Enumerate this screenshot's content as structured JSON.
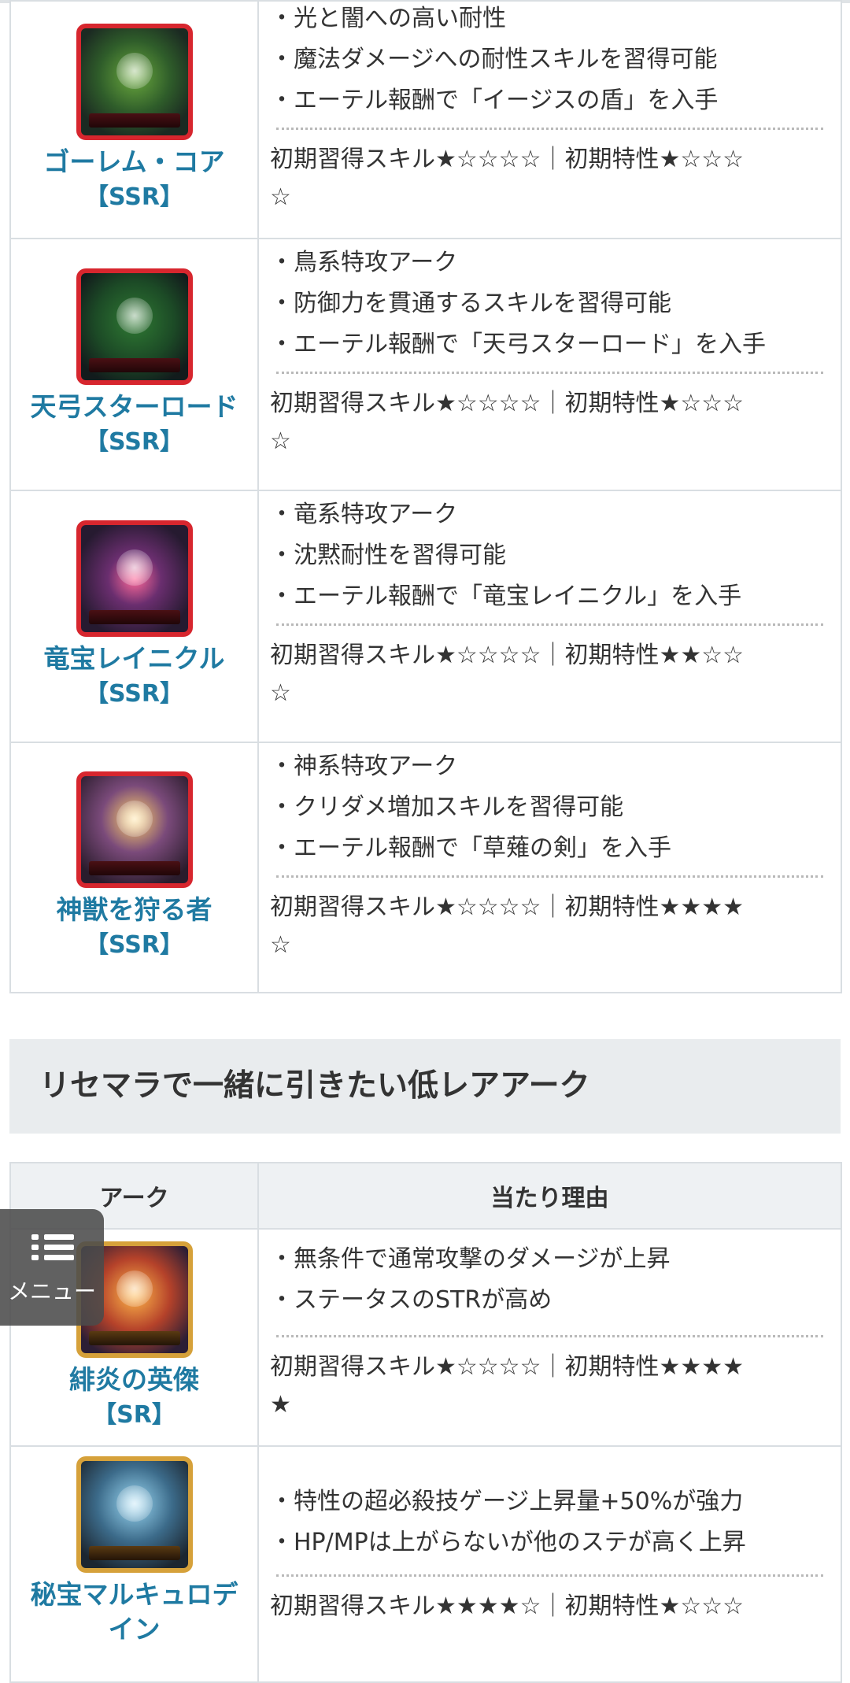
{
  "top_table": {
    "rows": [
      {
        "name": "ゴーレム・コア",
        "rarity": "【SSR】",
        "bullets": [
          "・光と闇への高い耐性",
          "・魔法ダメージへの耐性スキルを習得可能",
          "・エーテル報酬で「イージスの盾」を入手"
        ],
        "stars_line1": "初期習得スキル★☆☆☆☆｜初期特性★☆☆☆",
        "stars_line2": "☆"
      },
      {
        "name": "天弓スターロード",
        "rarity": "【SSR】",
        "bullets": [
          "・鳥系特攻アーク",
          "・防御力を貫通するスキルを習得可能",
          "・エーテル報酬で「天弓スターロード」を入手"
        ],
        "stars_line1": "初期習得スキル★☆☆☆☆｜初期特性★☆☆☆",
        "stars_line2": "☆"
      },
      {
        "name": "竜宝レイニクル",
        "rarity": "【SSR】",
        "bullets": [
          "・竜系特攻アーク",
          "・沈黙耐性を習得可能",
          "・エーテル報酬で「竜宝レイニクル」を入手"
        ],
        "stars_line1": "初期習得スキル★☆☆☆☆｜初期特性★★☆☆",
        "stars_line2": "☆"
      },
      {
        "name": "神獣を狩る者",
        "rarity": "【SSR】",
        "bullets": [
          "・神系特攻アーク",
          "・クリダメ増加スキルを習得可能",
          "・エーテル報酬で「草薙の剣」を入手"
        ],
        "stars_line1": "初期習得スキル★☆☆☆☆｜初期特性★★★★",
        "stars_line2": "☆"
      }
    ]
  },
  "section": {
    "heading": "リセマラで一緒に引きたい低レアアーク"
  },
  "bottom_table": {
    "headers": [
      "アーク",
      "当たり理由"
    ],
    "rows": [
      {
        "name": "緋炎の英傑",
        "rarity": "【SR】",
        "bullets": [
          "・無条件で通常攻撃のダメージが上昇",
          "・ステータスのSTRが高め"
        ],
        "stars_line1": "初期習得スキル★☆☆☆☆｜初期特性★★★★",
        "stars_line2": "★"
      },
      {
        "name": "秘宝マルキュロデ",
        "name_cont": "イン",
        "bullets": [
          "・特性の超必殺技ゲージ上昇量+50%が強力",
          "・HP/MPは上がらないが他のステが高く上昇"
        ],
        "stars_line1": "初期習得スキル★★★★☆｜初期特性★☆☆☆"
      }
    ]
  },
  "menu": {
    "label": "メニュー",
    "icon": "list-menu-icon"
  },
  "colors": {
    "link_blue": "#1f7aa2",
    "ssr_frame": "#d7262e",
    "sr_frame": "#d6a13a"
  }
}
